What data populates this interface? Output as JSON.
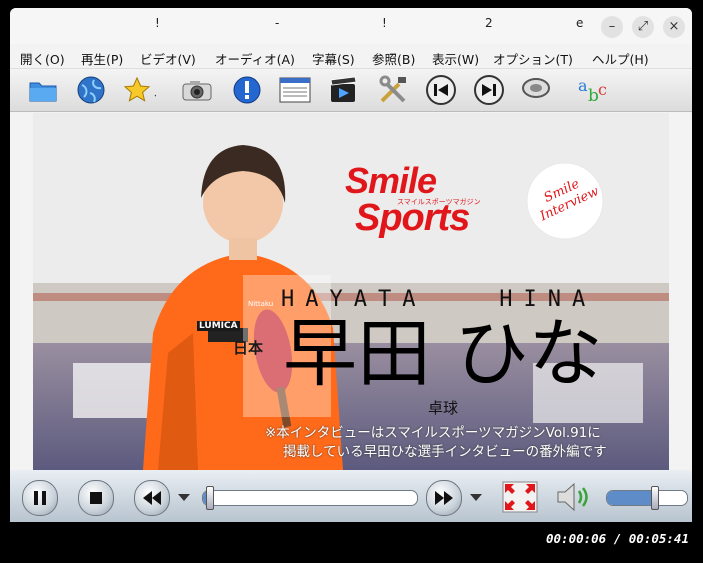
{
  "window": {
    "title_fragments": [
      "!",
      "-",
      "!",
      "2",
      "e"
    ],
    "minimize": "–",
    "maximize": "⤢",
    "close": "×"
  },
  "menu": [
    "開く(O)",
    "再生(P)",
    "ビデオ(V)",
    "オーディオ(A)",
    "字幕(S)",
    "参照(B)",
    "表示(W)",
    "オプション(T)",
    "ヘルプ(H)"
  ],
  "toolbar_icons": [
    "folder-icon",
    "globe-icon",
    "star-icon",
    "camera-icon",
    "info-icon",
    "playlist-icon",
    "clapper-icon",
    "tools-icon",
    "prev-icon",
    "next-icon",
    "audio-icon",
    "subtitle-icon"
  ],
  "video": {
    "brand_line1": "Smile",
    "brand_line2": "Sports",
    "brand_sub": "スマイルスポーツマガジン",
    "badge": "Smile Interview",
    "romaji": "HAYATA   HINA",
    "name": "早田 ひな",
    "sport": "卓球",
    "note_line1": "※本インタビューはスマイルスポーツマガジンVol.91に",
    "note_line2": "掲載している早田ひな選手インタビューの番外編です",
    "shirt_text": "LUMICA",
    "shirt_text2": "日本",
    "logo_small": "Nittaku"
  },
  "controls": {
    "progress": 0.018,
    "volume": 0.6
  },
  "status": {
    "time": "00:00:06 / 00:05:41"
  }
}
